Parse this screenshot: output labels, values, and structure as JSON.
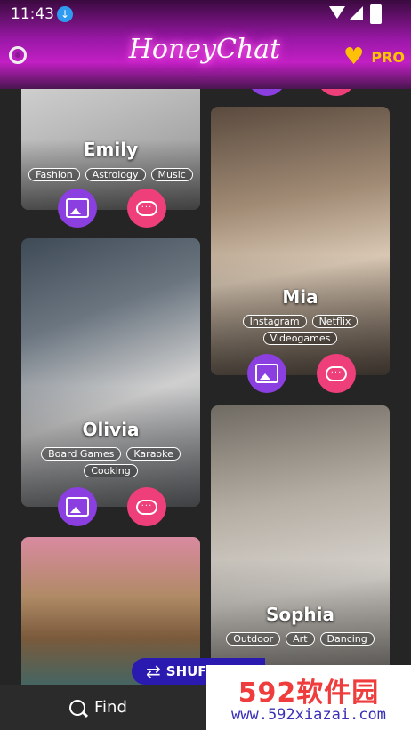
{
  "status": {
    "time": "11:43"
  },
  "header": {
    "logo": "HoneyChat",
    "pro_label": "PRO"
  },
  "cards": {
    "emily": {
      "name": "Emily",
      "tags": [
        "Fashion",
        "Astrology",
        "Music"
      ]
    },
    "mia": {
      "name": "Mia",
      "tags": [
        "Instagram",
        "Netflix",
        "Videogames"
      ]
    },
    "olivia": {
      "name": "Olivia",
      "tags": [
        "Board Games",
        "Karaoke",
        "Cooking"
      ]
    },
    "sophia": {
      "name": "Sophia",
      "tags": [
        "Outdoor",
        "Art",
        "Dancing"
      ]
    }
  },
  "bottom": {
    "find_label": "Find",
    "shuffle_label": "SHUFFLE"
  },
  "watermark": {
    "main": "592软件园",
    "url": "www.592xiazai.com"
  },
  "colors": {
    "gallery_button": "#8b3fe0",
    "chat_button": "#ef3f7a",
    "pro_accent": "#ffc400",
    "header_accent": "#c21fc4"
  },
  "icons": [
    "download-icon",
    "wifi-icon",
    "signal-icon",
    "battery-icon",
    "gear-icon",
    "heart-icon",
    "image-icon",
    "chat-bubble-icon",
    "search-icon",
    "shuffle-icon"
  ]
}
